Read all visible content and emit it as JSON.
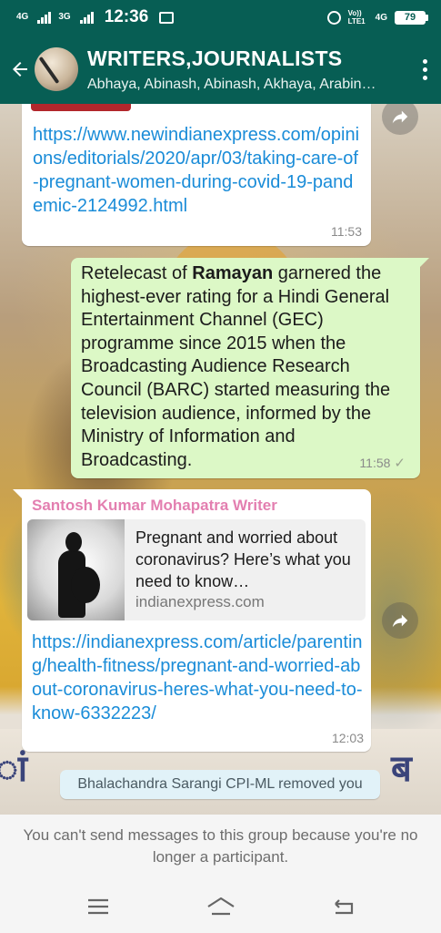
{
  "status_bar": {
    "network_1": "4G",
    "network_2": "3G",
    "time": "12:36",
    "volte": "Vo)) LTE1",
    "network_3": "4G",
    "battery": "79"
  },
  "header": {
    "title": "WRITERS,JOURNALISTS",
    "members": "Abhaya, Abinash, Abinash, Akhaya, Arabin…"
  },
  "messages": [
    {
      "type": "incoming",
      "link": "https://www.newindianexpress.com/opinions/editorials/2020/apr/03/taking-care-of-pregnant-women-during-covid-19-pandemic-2124992.html",
      "time": "11:53"
    },
    {
      "type": "outgoing",
      "text_prefix": "Retelecast of ",
      "text_bold": "Ramayan",
      "text_rest": " garnered the highest-ever rating for a Hindi General Entertainment Channel (GEC) programme since 2015 when the Broadcasting Audience Research Council (BARC) started measuring the television audience, informed by the Ministry of Information and Broadcasting.",
      "time": "11:58",
      "status": "✓"
    },
    {
      "type": "incoming",
      "sender": "Santosh Kumar Mohapatra Writer",
      "preview_title": "Pregnant and worried about coronavirus? Here’s what you need to know…",
      "preview_domain": "indianexpress.com",
      "link": "https://indianexpress.com/article/parenting/health-fitness/pregnant-and-worried-about-coronavirus-heres-what-you-need-to-know-6332223/",
      "time": "12:03"
    }
  ],
  "system_message": "Bhalachandra Sarangi CPI-ML removed you",
  "footer_notice": "You can't send messages to this group because you're no longer a participant.",
  "icons": {
    "back": "arrow-left-icon",
    "menu": "more-vertical-icon",
    "forward": "forward-icon",
    "nav_menu": "menu-icon",
    "nav_home": "home-icon",
    "nav_back": "back-icon"
  },
  "colors": {
    "header": "#075e54",
    "outgoing_bubble": "#dcf8c6",
    "incoming_bubble": "#ffffff",
    "link": "#1a8cd8",
    "sender_name": "#e37fb0",
    "system_bubble": "#e1f2f8"
  }
}
